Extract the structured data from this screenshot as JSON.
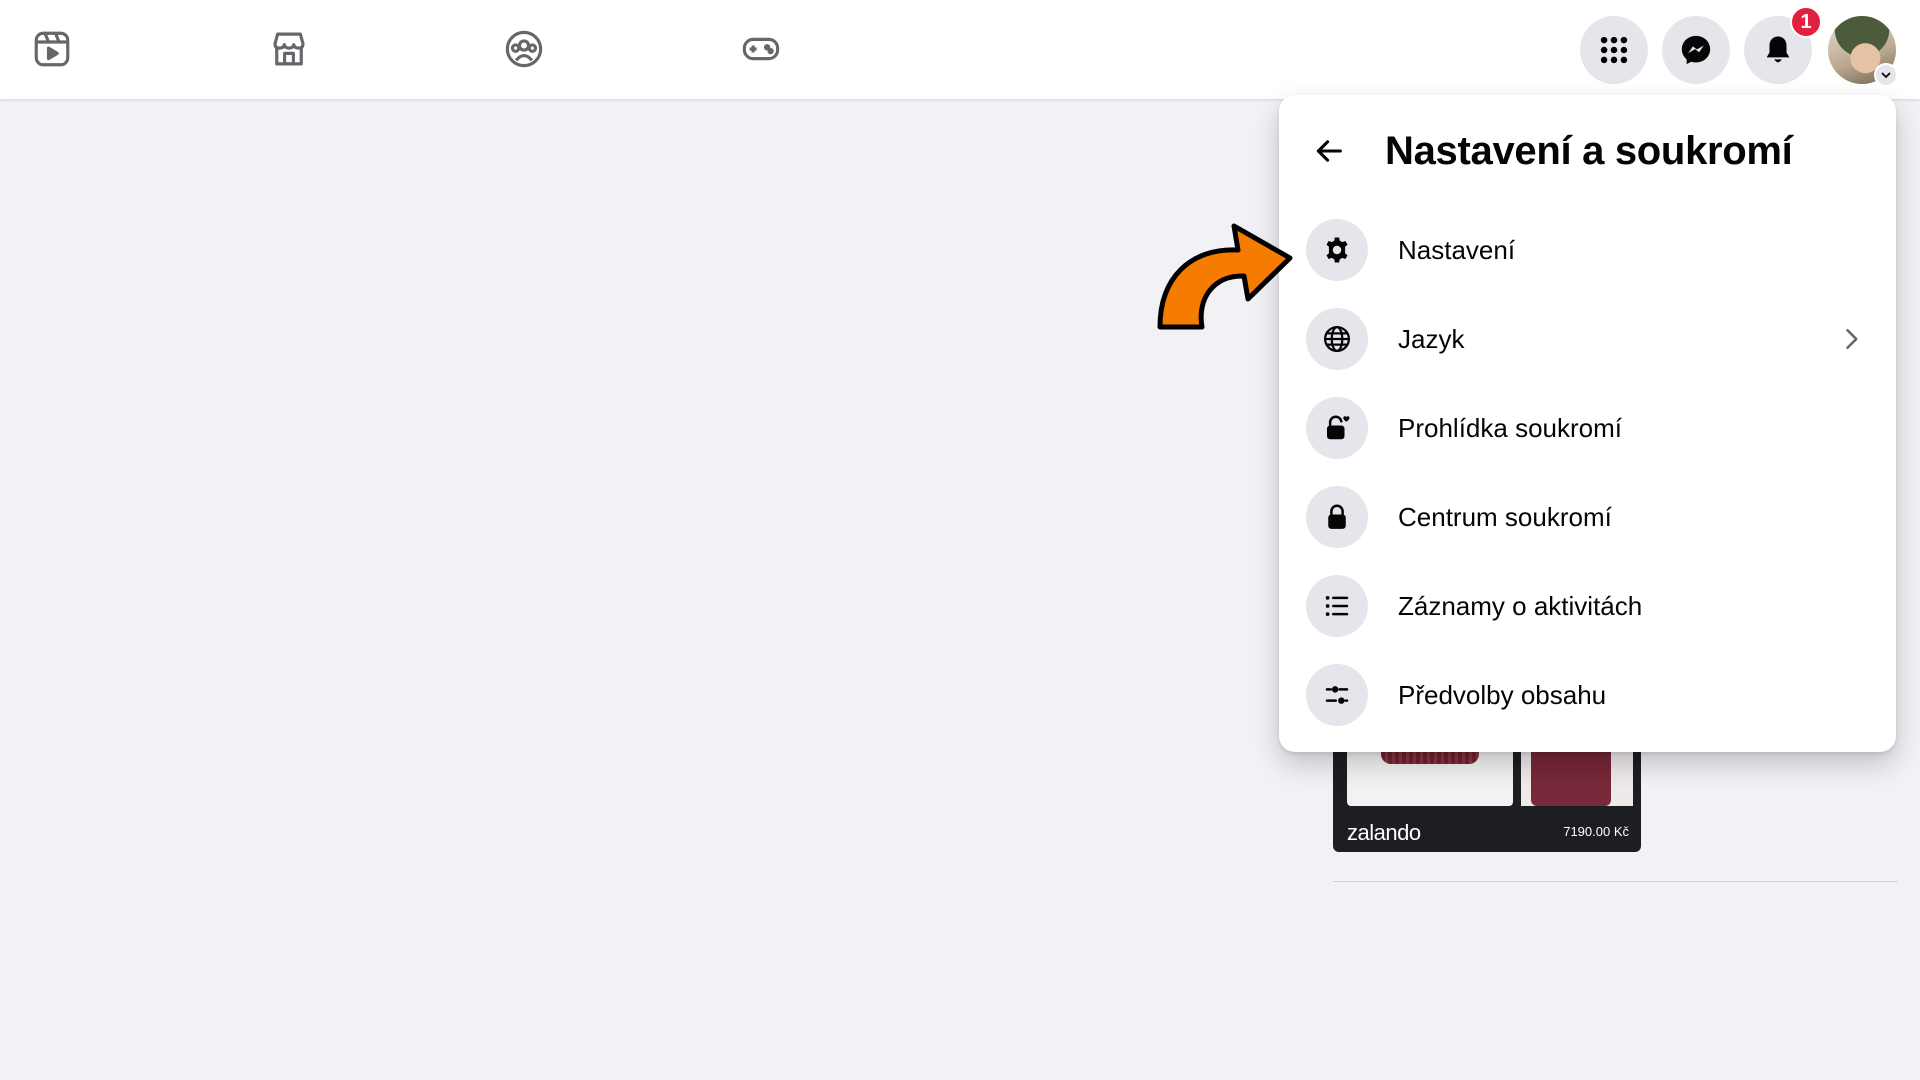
{
  "topbar": {
    "nav": [
      {
        "name": "video-icon"
      },
      {
        "name": "marketplace-icon"
      },
      {
        "name": "groups-icon"
      },
      {
        "name": "gaming-icon"
      }
    ],
    "menu_icon": "grid-menu-icon",
    "messenger_icon": "messenger-icon",
    "notifications_icon": "bell-icon",
    "notification_count": "1",
    "badge_color": "#e41e3f"
  },
  "panel": {
    "title": "Nastavení a soukromí",
    "back_icon": "arrow-left-icon",
    "items": [
      {
        "label": "Nastavení",
        "icon": "gear-icon"
      },
      {
        "label": "Jazyk",
        "icon": "globe-icon",
        "has_submenu": true
      },
      {
        "label": "Prohlídka soukromí",
        "icon": "lock-heart-icon"
      },
      {
        "label": "Centrum soukromí",
        "icon": "lock-icon"
      },
      {
        "label": "Záznamy o aktivitách",
        "icon": "list-icon"
      },
      {
        "label": "Předvolby obsahu",
        "icon": "sliders-icon"
      }
    ]
  },
  "ad": {
    "brand": "zalando",
    "price": "7190.00 Kč"
  },
  "colors": {
    "page_bg": "#f0f2f5",
    "icon_bg": "#e4e6eb",
    "arrow": "#f57c00"
  }
}
